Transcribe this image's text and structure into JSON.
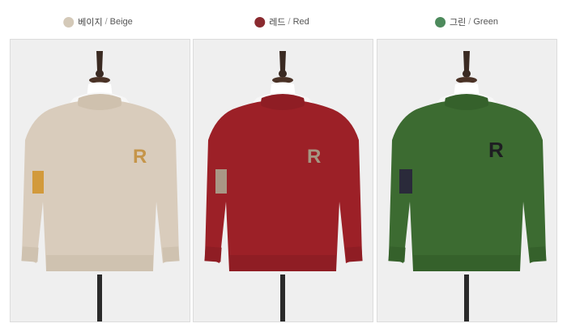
{
  "colors": [
    {
      "id": "beige",
      "label_ko": "베이지",
      "separator": "/",
      "label_en": "Beige",
      "hex": "#d9ccbc",
      "swatch": "#d4c9b8",
      "patch": "#d29a3c",
      "letter": "#c5954a"
    },
    {
      "id": "red",
      "label_ko": "레드",
      "separator": "/",
      "label_en": "Red",
      "hex": "#9c2027",
      "swatch": "#8a2a2f",
      "patch": "#a99785",
      "letter": "#a59682"
    },
    {
      "id": "green",
      "label_ko": "그린",
      "separator": "/",
      "label_en": "Green",
      "hex": "#3c6b31",
      "swatch": "#4d8a5c",
      "patch": "#2a2a3a",
      "letter": "#1e1e22"
    }
  ],
  "icons": {
    "dot": "color-dot-icon",
    "product": "sweater-on-mannequin"
  },
  "product_letter": "R"
}
